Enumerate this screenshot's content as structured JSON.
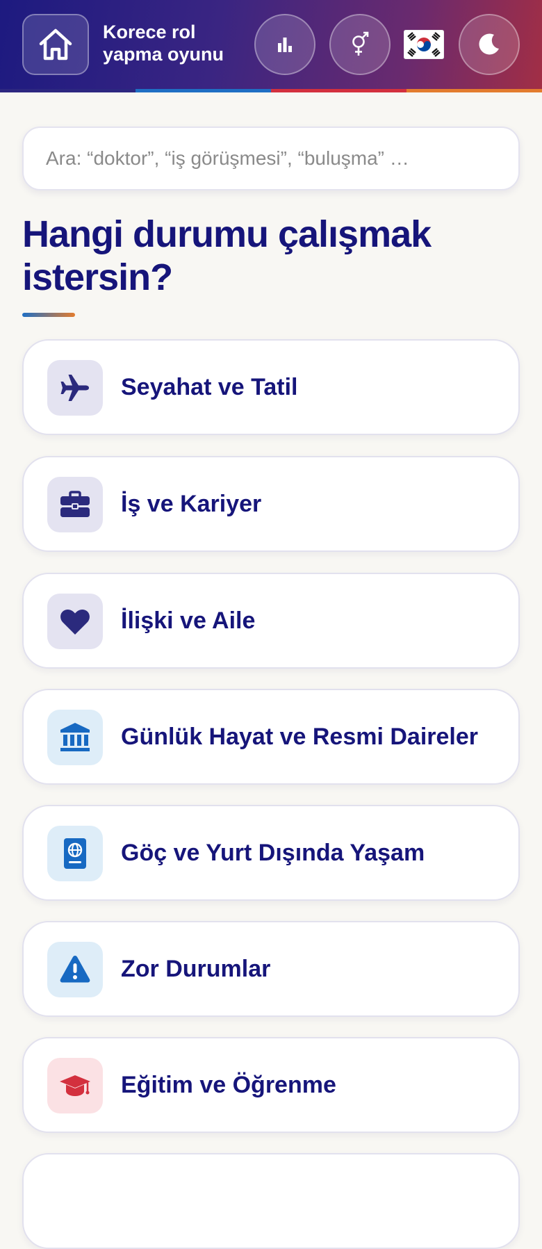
{
  "header": {
    "title_line1": "Korece rol",
    "title_line2": "yapma oyunu",
    "flag": "🇰🇷",
    "icons": [
      "home-icon",
      "bar-chart-icon",
      "gender-icon",
      "moon-icon"
    ],
    "stripe_colors": [
      "#2c2780",
      "#1f6fc4",
      "#d3303e",
      "#e37c2e"
    ]
  },
  "search": {
    "placeholder": "Ara: “doktor”, “iş görüşmesi”, “buluşma” …",
    "value": ""
  },
  "main": {
    "heading": "Hangi durumu çalışmak istersin?",
    "categories": [
      {
        "label": "Seyahat ve Tatil",
        "icon": "airplane-icon",
        "icon_bg": "#e4e3f1",
        "icon_color": "#2b2a7d"
      },
      {
        "label": "İş ve Kariyer",
        "icon": "briefcase-icon",
        "icon_bg": "#e4e3f1",
        "icon_color": "#2b2a7d"
      },
      {
        "label": "İlişki ve Aile",
        "icon": "heart-icon",
        "icon_bg": "#e4e3f1",
        "icon_color": "#2b2a7d"
      },
      {
        "label": "Günlük Hayat ve Resmi Daireler",
        "icon": "bank-icon",
        "icon_bg": "#deedf8",
        "icon_color": "#1769c2"
      },
      {
        "label": "Göç ve Yurt Dışında Yaşam",
        "icon": "passport-icon",
        "icon_bg": "#deedf8",
        "icon_color": "#1769c2"
      },
      {
        "label": "Zor Durumlar",
        "icon": "warning-icon",
        "icon_bg": "#deedf8",
        "icon_color": "#1769c2"
      },
      {
        "label": "Eğitim ve Öğrenme",
        "icon": "graduation-cap-icon",
        "icon_bg": "#fbe1e4",
        "icon_color": "#d3303e"
      }
    ]
  }
}
